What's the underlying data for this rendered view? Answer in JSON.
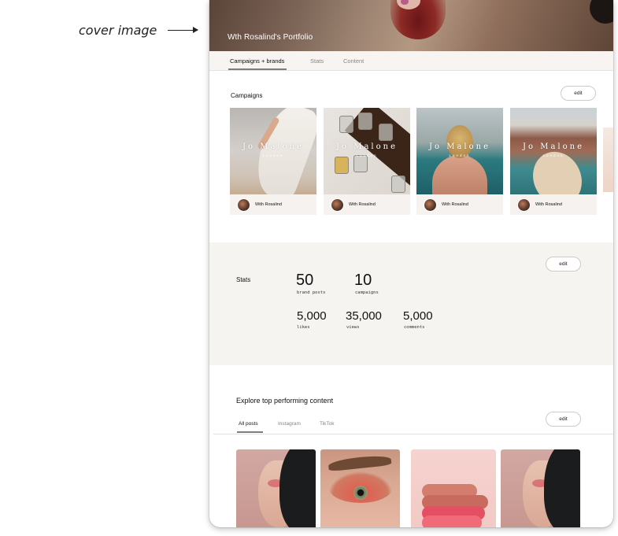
{
  "annotation": {
    "label": "cover image"
  },
  "cover": {
    "title": "Wth Rosalind's Portfolio"
  },
  "tabs": [
    {
      "label": "Campaigns + brands",
      "active": true
    },
    {
      "label": "Stats",
      "active": false
    },
    {
      "label": "Content",
      "active": false
    }
  ],
  "campaigns": {
    "title": "Campaigns",
    "edit_label": "edit",
    "cards": [
      {
        "brand": "Jo Malone",
        "brand_sub": "London",
        "creator": "With Rosalind"
      },
      {
        "brand": "Jo Malone",
        "brand_sub": "London",
        "creator": "With Rosalind"
      },
      {
        "brand": "Jo Malone",
        "brand_sub": "London",
        "creator": "With Rosalind"
      },
      {
        "brand": "Jo Malone",
        "brand_sub": "London",
        "creator": "With Rosalind"
      }
    ]
  },
  "stats": {
    "title": "Stats",
    "edit_label": "edit",
    "items": [
      {
        "value": "50",
        "label": "brand posts"
      },
      {
        "value": "10",
        "label": "campaigns"
      },
      {
        "value": "5,000",
        "label": "likes"
      },
      {
        "value": "35,000",
        "label": "views"
      },
      {
        "value": "5,000",
        "label": "comments"
      }
    ]
  },
  "content": {
    "title": "Explore top performing content",
    "edit_label": "edit",
    "tabs": [
      {
        "label": "All posts",
        "active": true
      },
      {
        "label": "Instagram",
        "active": false
      },
      {
        "label": "TikTok",
        "active": false
      }
    ]
  },
  "colors": {
    "panel_bg": "#f6f4f0",
    "tab_bar_bg": "#f7f4f1",
    "underline": "#7d7d7d"
  }
}
